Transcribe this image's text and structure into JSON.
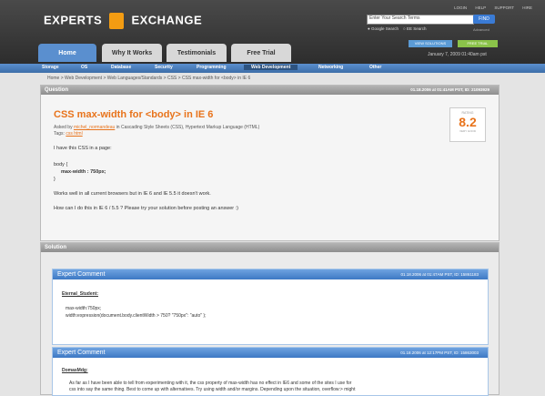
{
  "header": {
    "brand_left": "EXPERTS",
    "brand_right": "EXCHANGE",
    "top_links": [
      "LOGIN",
      "HELP",
      "SUPPORT",
      "HIRE"
    ],
    "search_placeholder": "Enter Your Search Terms",
    "find_label": "FIND",
    "search_opt1": "Google Search",
    "search_opt2": "EE Search",
    "advanced": "Advanced",
    "btn_view": "VIEW SOLUTIONS",
    "btn_free": "FREE TRIAL",
    "date": "January 7, 2009 01:40am pst"
  },
  "tabs": [
    "Home",
    "Why It Works",
    "Testimonials",
    "Free Trial"
  ],
  "subnav": [
    "Storage",
    "OS",
    "Database",
    "Security",
    "Programming",
    "Web Development",
    "Networking",
    "Other"
  ],
  "breadcrumb": "Home > Web Development > Web Languages/Standards > CSS > CSS max-width for <body> in IE 6",
  "question": {
    "header": "Question",
    "meta": "01.18.2006 at 01:41AM PST, ID: 21093929",
    "title": "CSS max-width for <body> in IE 6",
    "asked_prefix": "Asked by",
    "author": "michel_normandeau",
    "asked_suffix": "in Cascading Style Sheets (CSS), Hypertext Markup Language (HTML)",
    "tags_label": "Tags:",
    "tags": "css html",
    "lines": [
      "I have this CSS in a page:",
      "body {",
      "max-width : 750px;",
      "}",
      "Works well in all current browsers but in IE 6 and IE 5.5 it doesn't work.",
      "How can I do this in IE 6 / 5.5 ? Please try your solution before posting an answer :)"
    ],
    "grade_label": "RATING",
    "grade": "8.2",
    "grade_sub": "VERY GOOD"
  },
  "solution": {
    "header": "Solution",
    "comment1": {
      "title": "Expert Comment",
      "meta": "01.18.2006 at 01:47AM PST, ID: 15861183",
      "author": "Eternal_Student:",
      "lines": [
        "max-width:750px;",
        "width:expression(document.body.clientWidth > 750? \"750px\": \"auto\" );"
      ]
    },
    "comment2": {
      "title": "Expert Comment",
      "meta": "01.18.2006 at 12:17PM PST, ID: 15863003",
      "author": "DomasMdg:",
      "line1": "As far as I have been able to tell from experimenting with it, the css property of max-width has no effect in IE6 and some of the sites I use for",
      "line2": "css into say the same thing. Best to come up with alternatives. Try using width and/or margins. Depending upon the situation, overflow:> might"
    }
  }
}
